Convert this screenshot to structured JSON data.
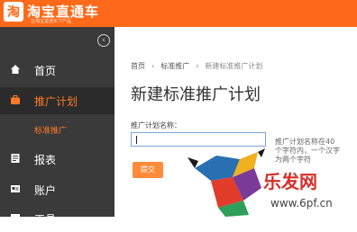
{
  "header": {
    "logo_text": "淘宝直通车",
    "tagline": "在淘宝直通车下产品",
    "brand_color": "#ff6a1a"
  },
  "sidebar": {
    "collapse_icon": "chevron-left-circle-icon",
    "items": [
      {
        "label": "首页",
        "icon": "home-icon"
      },
      {
        "label": "推广计划",
        "icon": "briefcase-icon"
      },
      {
        "label": "报表",
        "icon": "report-icon"
      },
      {
        "label": "账户",
        "icon": "account-icon"
      },
      {
        "label": "工具",
        "icon": "tool-icon"
      }
    ],
    "subitem": "标准推广",
    "active_color": "#ff7a28"
  },
  "breadcrumb": [
    "首页",
    "标准推广",
    "新建标准推广计划"
  ],
  "page_title": "新建标准推广计划",
  "form": {
    "label": "推广计划名称：",
    "value": "",
    "hint": "推广计划名称在40个字符内，一个汉字为两个字符",
    "submit": "提交"
  },
  "watermark": {
    "text": "乐发网",
    "url": "www.6pf.cn"
  }
}
